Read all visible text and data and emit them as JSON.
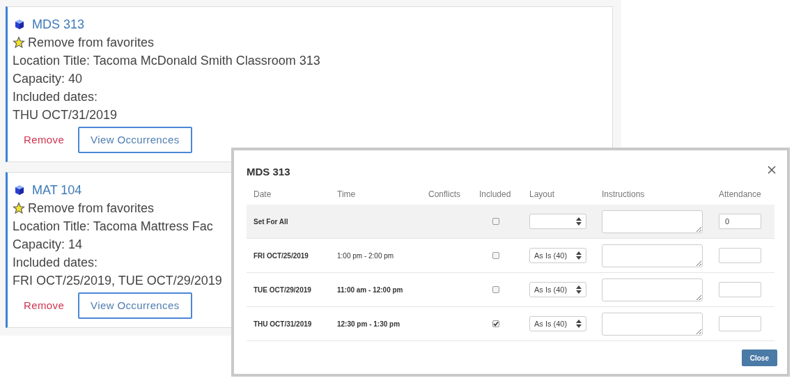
{
  "cards": [
    {
      "title": "MDS 313",
      "favorite": "Remove from favorites",
      "location": "Location Title: Tacoma McDonald Smith Classroom 313",
      "capacity": "Capacity: 40",
      "dates_label": "Included dates:",
      "dates": "THU OCT/31/2019",
      "remove": "Remove",
      "view": "View Occurrences"
    },
    {
      "title": "MAT 104",
      "favorite": "Remove from favorites",
      "location": "Location Title: Tacoma Mattress Fac",
      "capacity": "Capacity: 14",
      "dates_label": "Included dates:",
      "dates": "FRI OCT/25/2019, TUE OCT/29/2019",
      "remove": "Remove",
      "view": "View Occurrences"
    }
  ],
  "modal": {
    "title": "MDS 313",
    "columns": [
      "Date",
      "Time",
      "Conflicts",
      "Included",
      "Layout",
      "Instructions",
      "Attendance"
    ],
    "rows": [
      {
        "kind": "set_all",
        "date": "Set For All",
        "included": false,
        "attendance": "0"
      },
      {
        "kind": "occurrence",
        "date": "FRI OCT/25/2019",
        "time": "1:00 pm - 2:00 pm",
        "emphasized": false,
        "included": false,
        "layout": "As Is (40)"
      },
      {
        "kind": "occurrence",
        "date": "TUE OCT/29/2019",
        "time": "11:00 am - 12:00 pm",
        "emphasized": true,
        "included": false,
        "layout": "As Is (40)"
      },
      {
        "kind": "occurrence",
        "date": "THU OCT/31/2019",
        "time": "12:30 pm - 1:30 pm",
        "emphasized": true,
        "included": true,
        "layout": "As Is (40)"
      }
    ],
    "close_button": "Close"
  }
}
